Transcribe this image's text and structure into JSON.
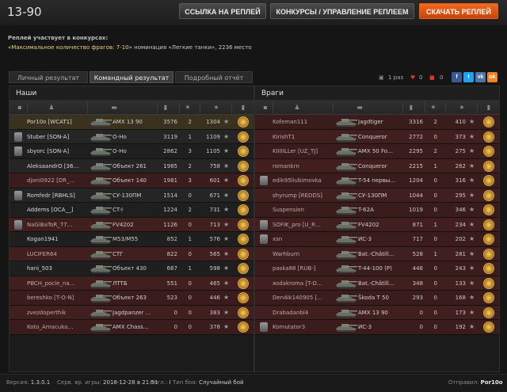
{
  "header": {
    "title": "13-90",
    "btn_link": "ССЫЛКА НА РЕПЛЕЙ",
    "btn_contests": "КОНКУРСЫ / УПРАВЛЕНИЕ РЕПЛЕЕМ",
    "btn_download": "СКАЧАТЬ РЕПЛЕЙ"
  },
  "contest": {
    "label": "Реплей участвует в конкурсах:",
    "entry_quote_open": "«",
    "entry_name": "Максимальное количество фрагов: 7-10",
    "entry_rest": "» номинация «Легкие танки», 2236 место"
  },
  "tabs": [
    "Личный результат",
    "Командный результат",
    "Подробный отчёт"
  ],
  "share": {
    "count": "1 раз",
    "likes": "0",
    "comments": "0"
  },
  "colors": {
    "accent": "#e8552a",
    "dead_row": "#3a1c1c"
  },
  "allies": {
    "title": "Наши",
    "rows": [
      {
        "name": "Por10o [WCAT1]",
        "tank": "AMX 13 90",
        "dmg": "3576",
        "frags": "2",
        "xp": "1304",
        "dead": false,
        "me": true
      },
      {
        "name": "Stuber [SON-A]",
        "tank": "O-Ho",
        "dmg": "3119",
        "frags": "1",
        "xp": "1109",
        "dead": false,
        "rank": true
      },
      {
        "name": "sbyorc [SON-A]",
        "tank": "O-Ho",
        "dmg": "2862",
        "frags": "3",
        "xp": "1105",
        "dead": false,
        "rank": true
      },
      {
        "name": "AleksaandrO [36…",
        "tank": "Объект 261",
        "dmg": "1985",
        "frags": "2",
        "xp": "758",
        "dead": false
      },
      {
        "name": "djoni0922 [DR_…",
        "tank": "Объект 140",
        "dmg": "1981",
        "frags": "3",
        "xp": "601",
        "dead": true
      },
      {
        "name": "Romfedr [RBHLS]",
        "tank": "СУ-130ПМ",
        "dmg": "1514",
        "frags": "0",
        "xp": "671",
        "dead": false,
        "rank": true
      },
      {
        "name": "Addems [OCA__]",
        "tank": "CT-I",
        "dmg": "1224",
        "frags": "2",
        "xp": "731",
        "dead": false
      },
      {
        "name": "NaGiBaToR_77…",
        "tank": "FV4202",
        "dmg": "1126",
        "frags": "0",
        "xp": "713",
        "dead": true,
        "rank": true
      },
      {
        "name": "Kogan1941",
        "tank": "M53/M55",
        "dmg": "852",
        "frags": "1",
        "xp": "576",
        "dead": false
      },
      {
        "name": "LUCIFER64",
        "tank": "СТГ",
        "dmg": "822",
        "frags": "0",
        "xp": "565",
        "dead": true
      },
      {
        "name": "hani_503",
        "tank": "Объект 430",
        "dmg": "667",
        "frags": "1",
        "xp": "598",
        "dead": false
      },
      {
        "name": "PBCH_pocle_na…",
        "tank": "ЛТТБ",
        "dmg": "551",
        "frags": "0",
        "xp": "465",
        "dead": true
      },
      {
        "name": "bereshko [T-O-N]",
        "tank": "Объект 263",
        "dmg": "523",
        "frags": "0",
        "xp": "446",
        "dead": true
      },
      {
        "name": "zvezdoperthik",
        "tank": "Jagdpanzer …",
        "dmg": "0",
        "frags": "0",
        "xp": "383",
        "dead": true
      },
      {
        "name": "Koto_Amacuka…",
        "tank": "AMX Chass…",
        "dmg": "0",
        "frags": "0",
        "xp": "378",
        "dead": true
      }
    ]
  },
  "enemies": {
    "title": "Враги",
    "rows": [
      {
        "name": "Kofeman111",
        "tank": "Jagdtiger",
        "dmg": "3316",
        "frags": "2",
        "xp": "410",
        "dead": true
      },
      {
        "name": "KirishT1",
        "tank": "Conqueror",
        "dmg": "2772",
        "frags": "0",
        "xp": "373",
        "dead": true
      },
      {
        "name": "KIIIIILLer [UZ_TJ]",
        "tank": "AMX 50 Fo…",
        "dmg": "2295",
        "frags": "2",
        "xp": "275",
        "dead": true
      },
      {
        "name": "romankrn",
        "tank": "Conqueror",
        "dmg": "2215",
        "frags": "1",
        "xp": "262",
        "dead": true
      },
      {
        "name": "edik95liubimovka",
        "tank": "T-54 первы…",
        "dmg": "1204",
        "frags": "0",
        "xp": "316",
        "dead": true,
        "rank": true
      },
      {
        "name": "shyrump [REDDS]",
        "tank": "СУ-130ПМ",
        "dmg": "1044",
        "frags": "0",
        "xp": "295",
        "dead": true
      },
      {
        "name": "Suspension",
        "tank": "T-62A",
        "dmg": "1019",
        "frags": "0",
        "xp": "346",
        "dead": true
      },
      {
        "name": "SOFIK_pro [U_R…",
        "tank": "FV4202",
        "dmg": "871",
        "frags": "1",
        "xp": "234",
        "dead": true,
        "rank": true
      },
      {
        "name": "xsn",
        "tank": "ИС-3",
        "dmg": "717",
        "frags": "0",
        "xp": "202",
        "dead": true,
        "rank": true
      },
      {
        "name": "Warhburn",
        "tank": "Bat.-Châtill…",
        "dmg": "528",
        "frags": "1",
        "xp": "281",
        "dead": true
      },
      {
        "name": "paska88 [RUB-]",
        "tank": "T-44-100 (P)",
        "dmg": "446",
        "frags": "0",
        "xp": "243",
        "dead": true
      },
      {
        "name": "xodakroma [T-O…",
        "tank": "Bat.-Châtill…",
        "dmg": "348",
        "frags": "0",
        "xp": "133",
        "dead": true
      },
      {
        "name": "Den4ik140905 […",
        "tank": "Škoda T 50",
        "dmg": "293",
        "frags": "0",
        "xp": "168",
        "dead": true
      },
      {
        "name": "Drabadanbl4",
        "tank": "AMX 13 90",
        "dmg": "0",
        "frags": "0",
        "xp": "173",
        "dead": true
      },
      {
        "name": "Komutator3",
        "tank": "ИС-3",
        "dmg": "0",
        "frags": "0",
        "xp": "192",
        "dead": true,
        "rank": true
      }
    ]
  },
  "footer": {
    "version_label": "Версия:",
    "version": "1.3.0.1",
    "server_label": "Серв. вр. игры:",
    "server_time": "2018-12-28 в 21:51",
    "region_label": "Регл.:",
    "region": "I",
    "battle_label": "Тип боя:",
    "battle_type": "Случайный бой",
    "sender_label": "Отправил:",
    "sender": "Por10o"
  }
}
